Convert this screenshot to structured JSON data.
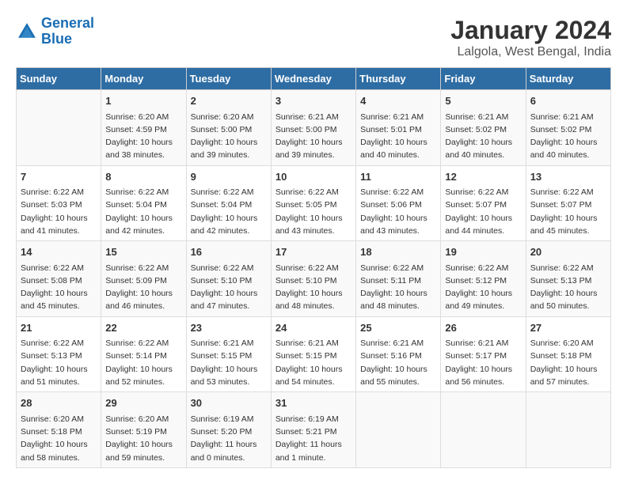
{
  "logo": {
    "text_general": "General",
    "text_blue": "Blue"
  },
  "title": "January 2024",
  "subtitle": "Lalgola, West Bengal, India",
  "header_row": [
    "Sunday",
    "Monday",
    "Tuesday",
    "Wednesday",
    "Thursday",
    "Friday",
    "Saturday"
  ],
  "weeks": [
    [
      {
        "day": "",
        "info": ""
      },
      {
        "day": "1",
        "info": "Sunrise: 6:20 AM\nSunset: 4:59 PM\nDaylight: 10 hours\nand 38 minutes."
      },
      {
        "day": "2",
        "info": "Sunrise: 6:20 AM\nSunset: 5:00 PM\nDaylight: 10 hours\nand 39 minutes."
      },
      {
        "day": "3",
        "info": "Sunrise: 6:21 AM\nSunset: 5:00 PM\nDaylight: 10 hours\nand 39 minutes."
      },
      {
        "day": "4",
        "info": "Sunrise: 6:21 AM\nSunset: 5:01 PM\nDaylight: 10 hours\nand 40 minutes."
      },
      {
        "day": "5",
        "info": "Sunrise: 6:21 AM\nSunset: 5:02 PM\nDaylight: 10 hours\nand 40 minutes."
      },
      {
        "day": "6",
        "info": "Sunrise: 6:21 AM\nSunset: 5:02 PM\nDaylight: 10 hours\nand 40 minutes."
      }
    ],
    [
      {
        "day": "7",
        "info": "Sunrise: 6:22 AM\nSunset: 5:03 PM\nDaylight: 10 hours\nand 41 minutes."
      },
      {
        "day": "8",
        "info": "Sunrise: 6:22 AM\nSunset: 5:04 PM\nDaylight: 10 hours\nand 42 minutes."
      },
      {
        "day": "9",
        "info": "Sunrise: 6:22 AM\nSunset: 5:04 PM\nDaylight: 10 hours\nand 42 minutes."
      },
      {
        "day": "10",
        "info": "Sunrise: 6:22 AM\nSunset: 5:05 PM\nDaylight: 10 hours\nand 43 minutes."
      },
      {
        "day": "11",
        "info": "Sunrise: 6:22 AM\nSunset: 5:06 PM\nDaylight: 10 hours\nand 43 minutes."
      },
      {
        "day": "12",
        "info": "Sunrise: 6:22 AM\nSunset: 5:07 PM\nDaylight: 10 hours\nand 44 minutes."
      },
      {
        "day": "13",
        "info": "Sunrise: 6:22 AM\nSunset: 5:07 PM\nDaylight: 10 hours\nand 45 minutes."
      }
    ],
    [
      {
        "day": "14",
        "info": "Sunrise: 6:22 AM\nSunset: 5:08 PM\nDaylight: 10 hours\nand 45 minutes."
      },
      {
        "day": "15",
        "info": "Sunrise: 6:22 AM\nSunset: 5:09 PM\nDaylight: 10 hours\nand 46 minutes."
      },
      {
        "day": "16",
        "info": "Sunrise: 6:22 AM\nSunset: 5:10 PM\nDaylight: 10 hours\nand 47 minutes."
      },
      {
        "day": "17",
        "info": "Sunrise: 6:22 AM\nSunset: 5:10 PM\nDaylight: 10 hours\nand 48 minutes."
      },
      {
        "day": "18",
        "info": "Sunrise: 6:22 AM\nSunset: 5:11 PM\nDaylight: 10 hours\nand 48 minutes."
      },
      {
        "day": "19",
        "info": "Sunrise: 6:22 AM\nSunset: 5:12 PM\nDaylight: 10 hours\nand 49 minutes."
      },
      {
        "day": "20",
        "info": "Sunrise: 6:22 AM\nSunset: 5:13 PM\nDaylight: 10 hours\nand 50 minutes."
      }
    ],
    [
      {
        "day": "21",
        "info": "Sunrise: 6:22 AM\nSunset: 5:13 PM\nDaylight: 10 hours\nand 51 minutes."
      },
      {
        "day": "22",
        "info": "Sunrise: 6:22 AM\nSunset: 5:14 PM\nDaylight: 10 hours\nand 52 minutes."
      },
      {
        "day": "23",
        "info": "Sunrise: 6:21 AM\nSunset: 5:15 PM\nDaylight: 10 hours\nand 53 minutes."
      },
      {
        "day": "24",
        "info": "Sunrise: 6:21 AM\nSunset: 5:15 PM\nDaylight: 10 hours\nand 54 minutes."
      },
      {
        "day": "25",
        "info": "Sunrise: 6:21 AM\nSunset: 5:16 PM\nDaylight: 10 hours\nand 55 minutes."
      },
      {
        "day": "26",
        "info": "Sunrise: 6:21 AM\nSunset: 5:17 PM\nDaylight: 10 hours\nand 56 minutes."
      },
      {
        "day": "27",
        "info": "Sunrise: 6:20 AM\nSunset: 5:18 PM\nDaylight: 10 hours\nand 57 minutes."
      }
    ],
    [
      {
        "day": "28",
        "info": "Sunrise: 6:20 AM\nSunset: 5:18 PM\nDaylight: 10 hours\nand 58 minutes."
      },
      {
        "day": "29",
        "info": "Sunrise: 6:20 AM\nSunset: 5:19 PM\nDaylight: 10 hours\nand 59 minutes."
      },
      {
        "day": "30",
        "info": "Sunrise: 6:19 AM\nSunset: 5:20 PM\nDaylight: 11 hours\nand 0 minutes."
      },
      {
        "day": "31",
        "info": "Sunrise: 6:19 AM\nSunset: 5:21 PM\nDaylight: 11 hours\nand 1 minute."
      },
      {
        "day": "",
        "info": ""
      },
      {
        "day": "",
        "info": ""
      },
      {
        "day": "",
        "info": ""
      }
    ]
  ]
}
